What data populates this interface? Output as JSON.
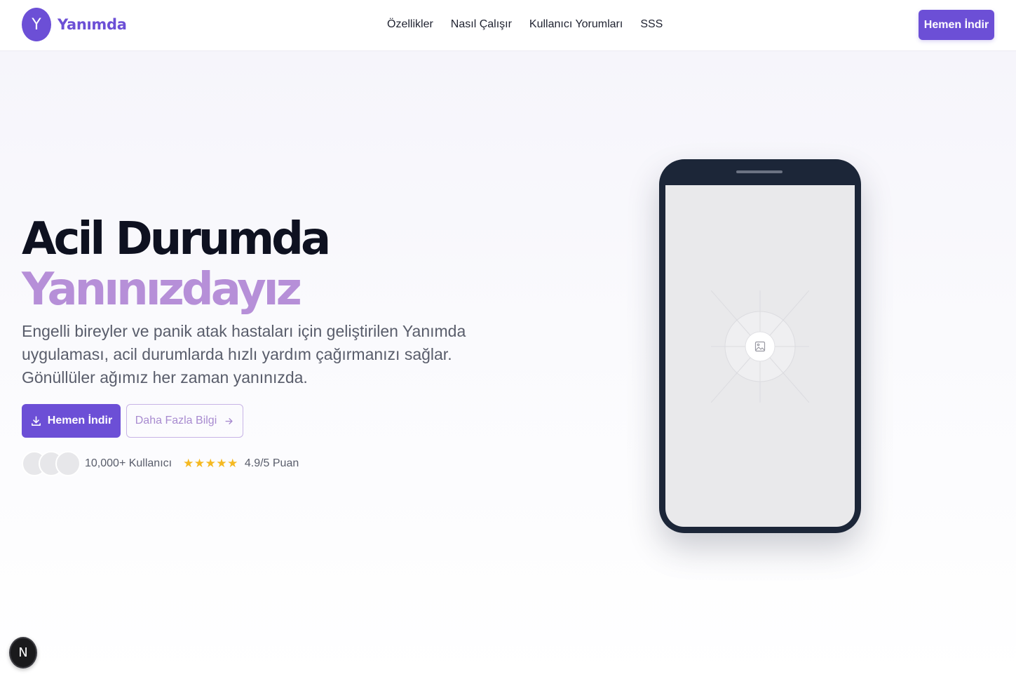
{
  "header": {
    "logo_letter": "Y",
    "brand": "Yanımda",
    "nav": [
      {
        "label": "Özellikler"
      },
      {
        "label": "Nasıl Çalışır"
      },
      {
        "label": "Kullanıcı Yorumları"
      },
      {
        "label": "SSS"
      }
    ],
    "cta_label": "Hemen İndir"
  },
  "hero": {
    "title_line1": "Acil Durumda",
    "title_line2": "Yanınızdayız",
    "description": "Engelli bireyler ve panik atak hastaları için geliştirilen Yanımda uygulaması, acil durumlarda hızlı yardım çağırmanızı sağlar. Gönüllüler ağımız her zaman yanınızda.",
    "primary_button": "Hemen İndir",
    "primary_button_icon": "download-icon",
    "secondary_button": "Daha Fazla Bilgi",
    "secondary_button_icon": "arrow-right-icon",
    "users_count": "10,000+ Kullanıcı",
    "stars": 5,
    "rating": "4.9/5 Puan"
  },
  "phone": {
    "screen_icon": "image-placeholder-icon"
  },
  "dev_badge": {
    "letter": "N"
  },
  "colors": {
    "accent": "#6c4fd6",
    "title_highlight": "#b68fd8",
    "star": "#f5b921",
    "phone_frame": "#1c2638",
    "screen": "#e9e9eb"
  }
}
